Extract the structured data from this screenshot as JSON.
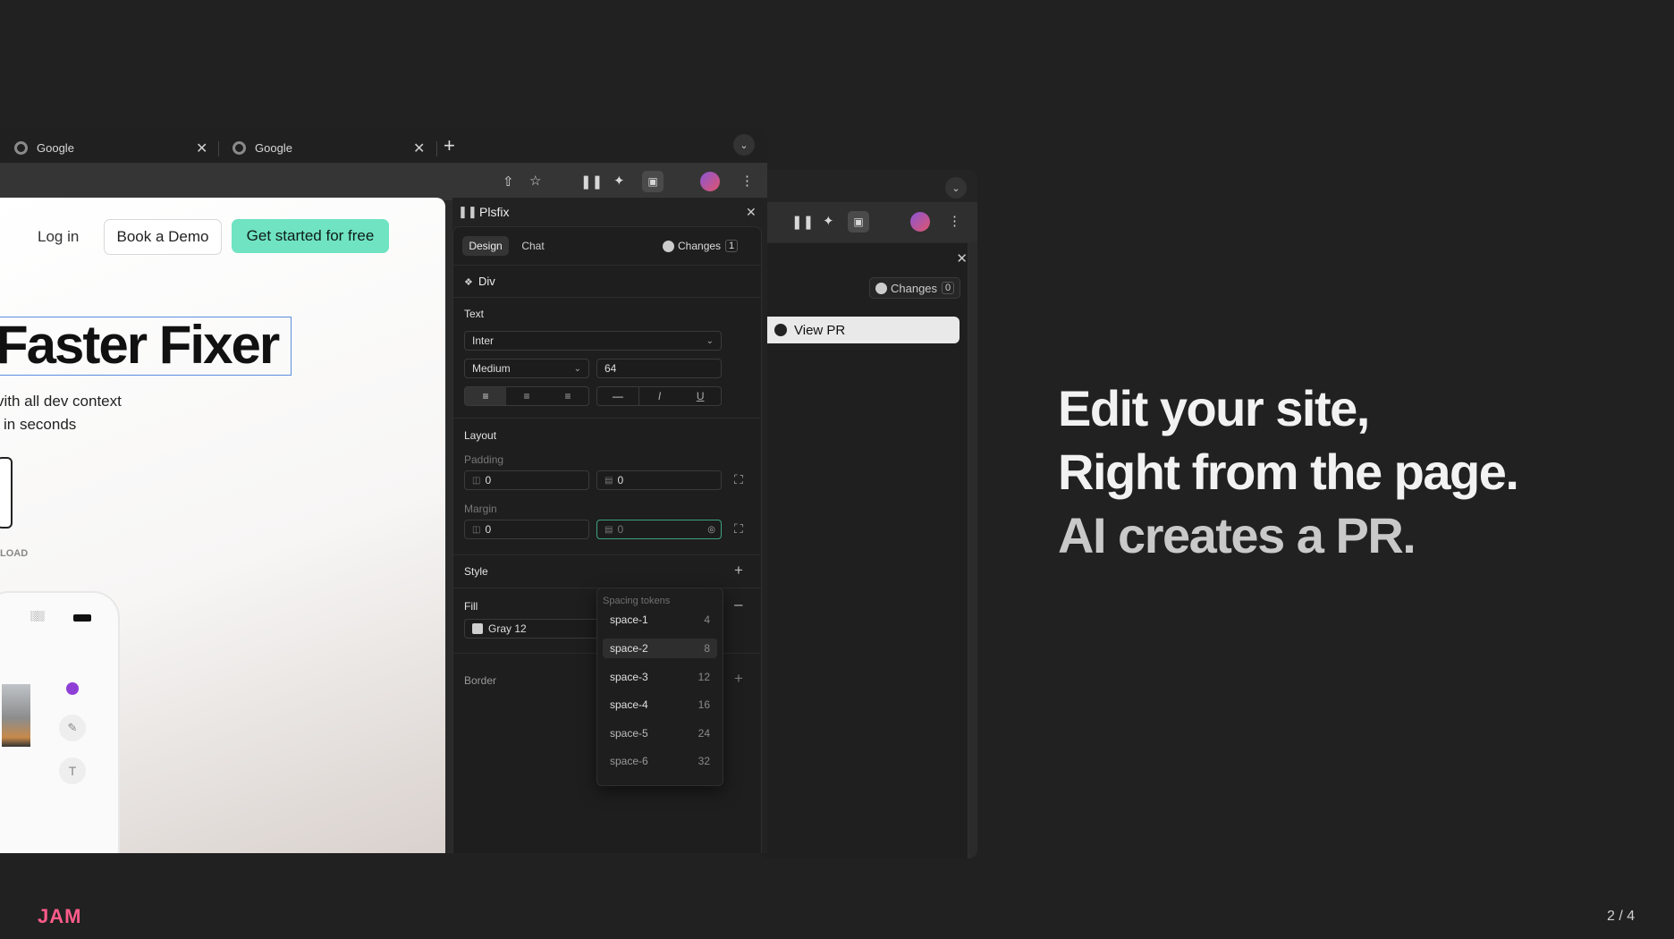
{
  "browser": {
    "tabs": [
      {
        "label": "Google"
      },
      {
        "label": "Google"
      }
    ],
    "new_tab": "+"
  },
  "site": {
    "login": "Log in",
    "demo_button": "Book a Demo",
    "cta_button": "Get started for free",
    "hero_title": "Faster Fixer",
    "subtitle_line1": "vith all dev context",
    "subtitle_line2": "in seconds",
    "download_label": "LOAD"
  },
  "plsfix": {
    "title": "Plsfix",
    "tabs": {
      "design": "Design",
      "chat": "Chat"
    },
    "changes_label": "Changes",
    "changes_count": "1",
    "element": "Div",
    "text_section": "Text",
    "font_family": "Inter",
    "font_weight": "Medium",
    "font_size": "64",
    "layout_section": "Layout",
    "padding_label": "Padding",
    "padding_values": [
      "0",
      "0"
    ],
    "margin_label": "Margin",
    "margin_values": [
      "0",
      "0"
    ],
    "style_section": "Style",
    "fill_section": "Fill",
    "fill_value": "Gray 12",
    "border_section": "Border",
    "tokens_header": "Spacing tokens",
    "tokens": [
      {
        "name": "space-1",
        "value": "4"
      },
      {
        "name": "space-2",
        "value": "8"
      },
      {
        "name": "space-3",
        "value": "12"
      },
      {
        "name": "space-4",
        "value": "16"
      },
      {
        "name": "space-5",
        "value": "24"
      },
      {
        "name": "space-6",
        "value": "32"
      }
    ]
  },
  "back_window": {
    "changes_label": "Changes",
    "changes_count": "0",
    "view_pr": "View PR"
  },
  "headline": {
    "line1": "Edit your site,",
    "line2": "Right from the page.",
    "line3": "AI creates a PR."
  },
  "footer": {
    "logo": "JAM",
    "pagination": "2 / 4"
  },
  "colors": {
    "background": "#212121",
    "cta": "#6fe3c2",
    "logo": "#ff5c8a",
    "headline_dim": "#c9c9c9"
  }
}
